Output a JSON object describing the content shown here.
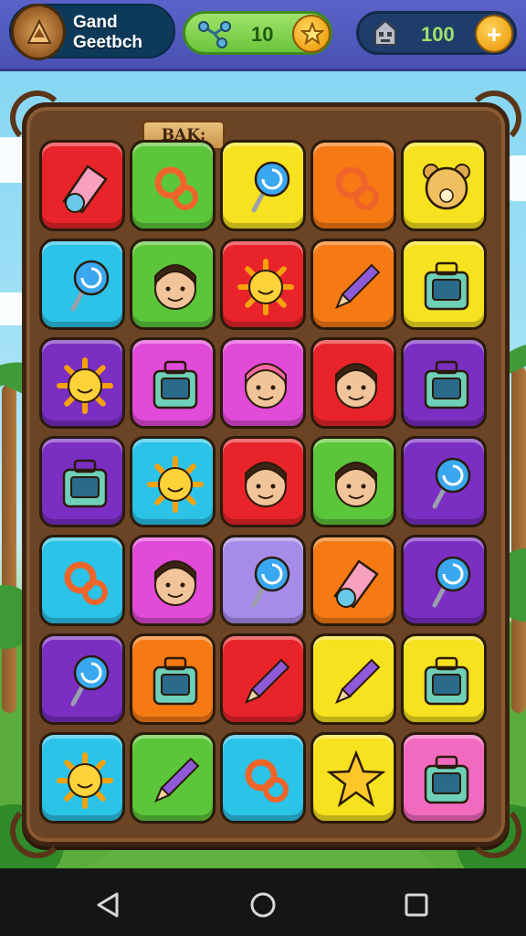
{
  "header": {
    "title_line1": "Gand",
    "title_line2": "Geetbch",
    "gems": {
      "value": "10",
      "icon": "molecule-icon",
      "button_icon": "star-icon"
    },
    "coins": {
      "value": "100",
      "icon": "robot-icon",
      "button_icon": "plus-icon",
      "button_label": "+"
    }
  },
  "board": {
    "sign_label": "BAK:",
    "tiles": [
      {
        "color": "#e8242a",
        "icon": "eraser-icon"
      },
      {
        "color": "#5cc63a",
        "icon": "magnifier-tool-icon"
      },
      {
        "color": "#f6e21e",
        "icon": "lollipop-key-icon"
      },
      {
        "color": "#f57a14",
        "icon": "gear-tools-icon"
      },
      {
        "color": "#f6e21e",
        "icon": "teddy-bear-icon"
      },
      {
        "color": "#2bc3e8",
        "icon": "balloon-icon"
      },
      {
        "color": "#5cc63a",
        "icon": "man-hat-avatar-icon"
      },
      {
        "color": "#e8242a",
        "icon": "sun-face-icon"
      },
      {
        "color": "#f57a14",
        "icon": "pencil-icon"
      },
      {
        "color": "#f6e21e",
        "icon": "briefcase-icon"
      },
      {
        "color": "#7a2ec2",
        "icon": "sun-gear-icon"
      },
      {
        "color": "#e24ad8",
        "icon": "walkie-talkie-icon"
      },
      {
        "color": "#e24ad8",
        "icon": "pink-hair-avatar-icon"
      },
      {
        "color": "#e8242a",
        "icon": "man-avatar-icon"
      },
      {
        "color": "#7a2ec2",
        "icon": "leaf-box-icon"
      },
      {
        "color": "#7a2ec2",
        "icon": "toy-box-icon"
      },
      {
        "color": "#2bc3e8",
        "icon": "smiling-sun-icon"
      },
      {
        "color": "#e8242a",
        "icon": "boy-avatar-icon"
      },
      {
        "color": "#5cc63a",
        "icon": "explorer-avatar-icon"
      },
      {
        "color": "#7a2ec2",
        "icon": "robot-pin-icon"
      },
      {
        "color": "#2bc3e8",
        "icon": "gear-ring-icon"
      },
      {
        "color": "#e24ad8",
        "icon": "girl-avatar-icon"
      },
      {
        "color": "#a78be8",
        "icon": "pouch-icon"
      },
      {
        "color": "#f57a14",
        "icon": "wrench-icon"
      },
      {
        "color": "#7a2ec2",
        "icon": "spiral-lollipop-icon"
      },
      {
        "color": "#7a2ec2",
        "icon": "ice-cream-icon"
      },
      {
        "color": "#f57a14",
        "icon": "radio-device-icon"
      },
      {
        "color": "#e8242a",
        "icon": "pen-icon"
      },
      {
        "color": "#f6e21e",
        "icon": "marker-icon"
      },
      {
        "color": "#f6e21e",
        "icon": "tablet-icon"
      },
      {
        "color": "#2bc3e8",
        "icon": "sun-icon"
      },
      {
        "color": "#5cc63a",
        "icon": "crayon-icon"
      },
      {
        "color": "#2bc3e8",
        "icon": "rings-icon"
      },
      {
        "color": "#f6e21e",
        "icon": "star-icon"
      },
      {
        "color": "#f26ac0",
        "icon": "shopping-bag-icon"
      }
    ]
  },
  "navbar": {
    "back_icon": "back-triangle-icon",
    "home_icon": "home-circle-icon",
    "recents_icon": "recents-square-icon"
  }
}
